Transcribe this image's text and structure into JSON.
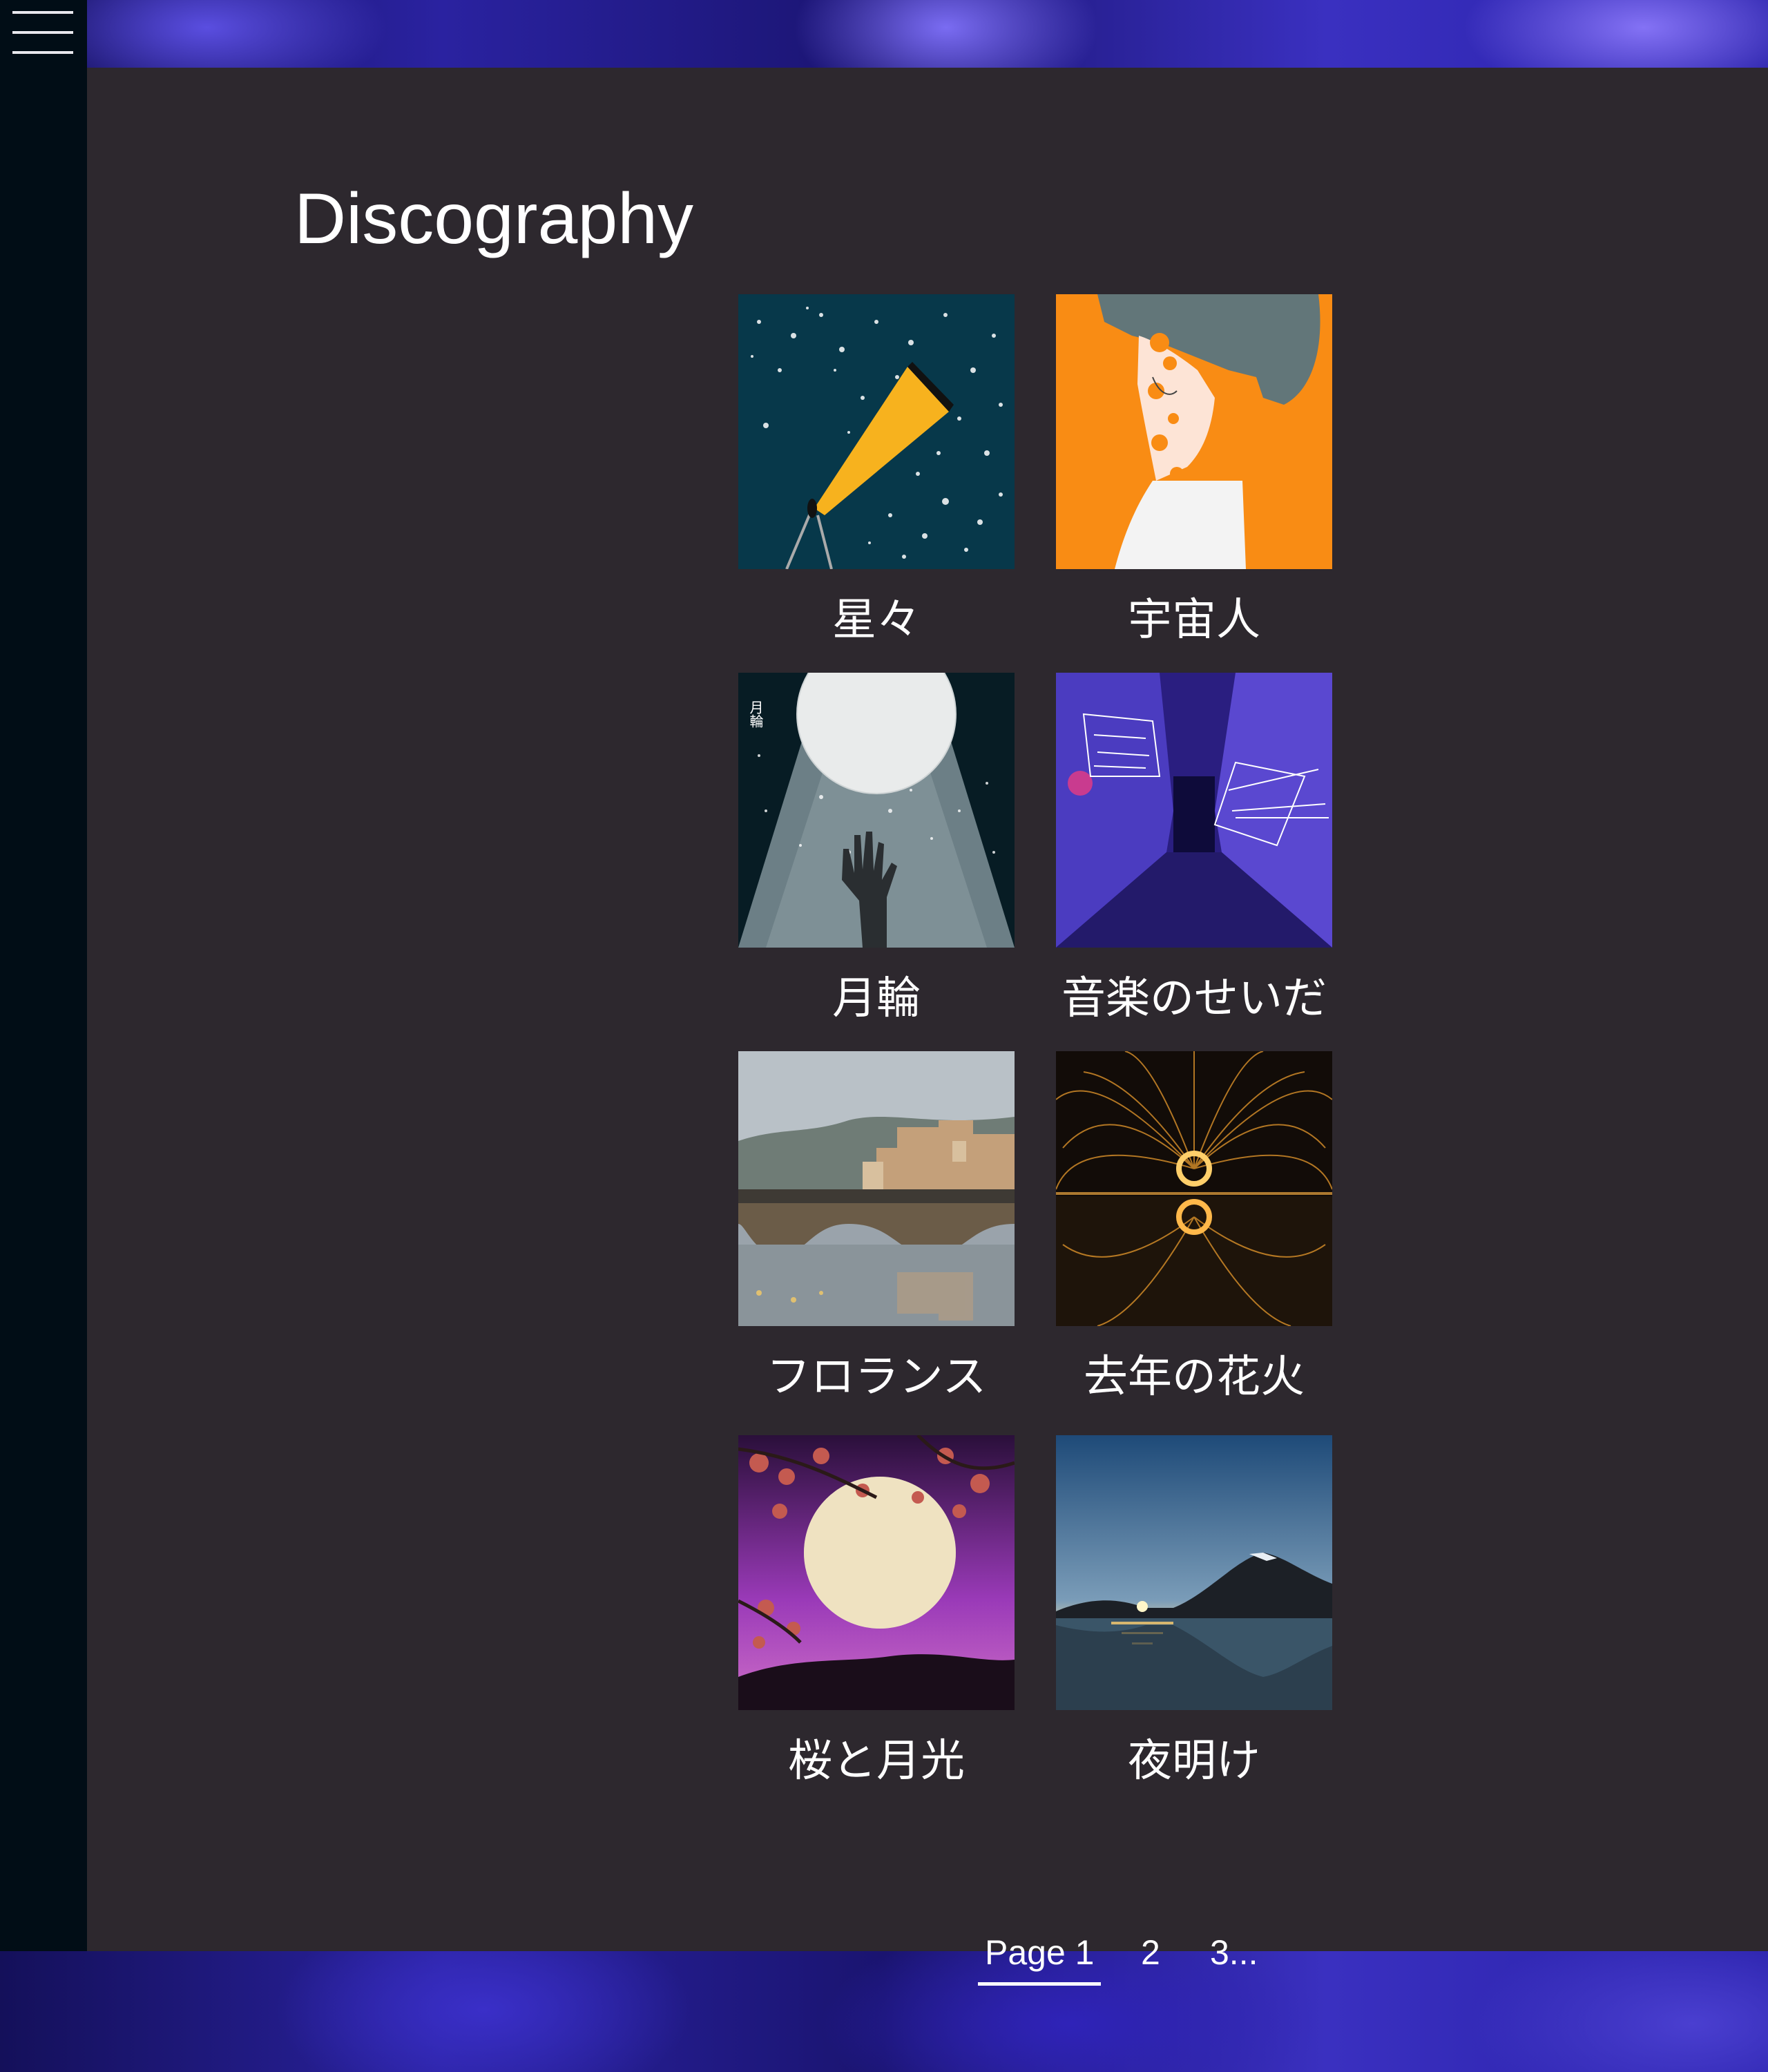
{
  "menu": {
    "icon": "hamburger-menu-icon"
  },
  "page": {
    "title": "Discography"
  },
  "albums": [
    {
      "title": "星々",
      "cover": "telescope-starry-sky-art"
    },
    {
      "title": "宇宙人",
      "cover": "orange-portrait-art"
    },
    {
      "title": "月輪",
      "cover": "moon-hand-art",
      "cover_text": "月輪"
    },
    {
      "title": "音楽のせいだ",
      "cover": "neon-alley-photo"
    },
    {
      "title": "フロランス",
      "cover": "florence-bridge-photo"
    },
    {
      "title": "去年の花火",
      "cover": "steel-wool-fireworks-photo"
    },
    {
      "title": "桜と月光",
      "cover": "cherry-blossom-moon-art"
    },
    {
      "title": "夜明け",
      "cover": "mountain-sunrise-photo"
    }
  ],
  "pagination": {
    "current": "Page 1",
    "pages": [
      "2",
      "3..."
    ]
  }
}
